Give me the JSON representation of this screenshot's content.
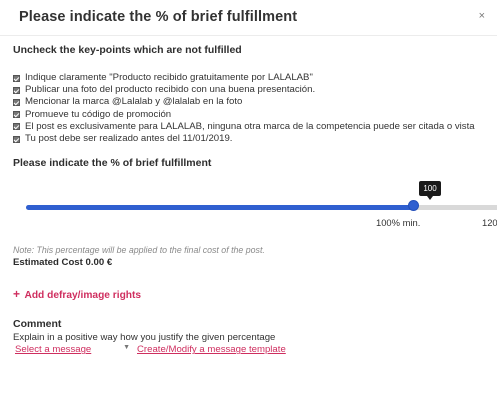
{
  "modal": {
    "title": "Please indicate the % of brief fulfillment",
    "close": "×"
  },
  "keypoints": {
    "heading": "Uncheck the key-points which are not fulfilled",
    "items": [
      {
        "label": "Indique claramente \"Producto recibido gratuitamente por LALALAB\"",
        "checked": true
      },
      {
        "label": "Publicar una foto del producto recibido con una buena presentación.",
        "checked": true
      },
      {
        "label": "Mencionar la marca @Lalalab y @lalalab en la foto",
        "checked": true
      },
      {
        "label": "Promueve tu código de promoción",
        "checked": true
      },
      {
        "label": "El post es exclusivamente para LALALAB, ninguna otra marca de la competencia puede ser citada o vista",
        "checked": true
      },
      {
        "label": "Tu post debe ser realizado antes del 11/01/2019.",
        "checked": true
      }
    ]
  },
  "fulfillment": {
    "heading": "Please indicate the % of brief fulfillment",
    "value": 100,
    "value_label": "100",
    "min_label": "100% min.",
    "max_label": "120%",
    "slider_max": 120,
    "accent": "#2f5fd0"
  },
  "cost": {
    "note": "Note: This percentage will be applied to the final cost of the post.",
    "estimated": "Estimated Cost 0.00 €"
  },
  "defray": {
    "plus": "+",
    "label": "Add defray/image rights",
    "color": "#cf2e5f"
  },
  "comment": {
    "title": "Comment",
    "text": "Explain in a positive way how you justify the given percentage",
    "select_value": "Select a message",
    "select_caret": "▼",
    "template_link": "Create/Modify a message template"
  }
}
